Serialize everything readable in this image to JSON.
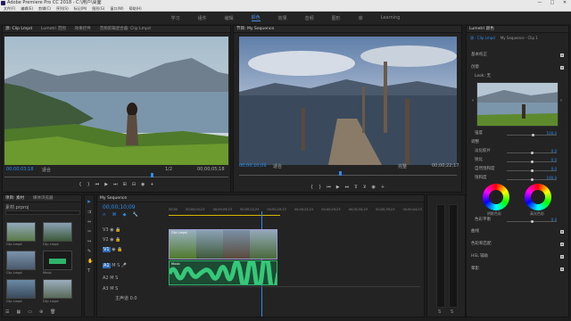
{
  "app": {
    "title": "Adobe Premiere Pro CC 2018 - C:\\用户\\桌面",
    "win_min": "—",
    "win_max": "□",
    "win_close": "✕"
  },
  "menu": [
    "文件(F)",
    "编辑(E)",
    "剪辑(C)",
    "序列(S)",
    "标记(M)",
    "图形(G)",
    "窗口(W)",
    "帮助(H)"
  ],
  "workspaces": [
    {
      "label": "学习"
    },
    {
      "label": "组件"
    },
    {
      "label": "编辑"
    },
    {
      "label": "颜色",
      "active": true
    },
    {
      "label": "效果"
    },
    {
      "label": "音频"
    },
    {
      "label": "图形"
    },
    {
      "label": "库"
    },
    {
      "label": "Learning"
    }
  ],
  "source": {
    "tabs": [
      "源: Clip Lmpd",
      "Lumetri 范围",
      "效果控件",
      "音频剪辑混合器: Clip Lmpd"
    ],
    "timecode": "00;00;03;18",
    "fit": "适合",
    "full": "1/2",
    "duration": "00;00;05;18"
  },
  "program": {
    "tab": "节目: My Sequence",
    "timecode": "00;00;10;09",
    "fit": "适合",
    "full": "完整",
    "duration": "00;00;22;17"
  },
  "project": {
    "tabs": [
      "项目: 素材",
      "媒体浏览器"
    ],
    "path": "素材.prproj",
    "clips": [
      "Clip Lmpd",
      "Clip Lmpd",
      "Clip Lmpd",
      "Clip Lmpd",
      "Clip Lmpd",
      "Music"
    ]
  },
  "timeline": {
    "tab": "My Sequence",
    "timecode": "00;00;10;09",
    "ruler": [
      "00;00",
      "00;00;04;23",
      "00;00;09;23",
      "00;00;14;23",
      "00;00;19;23",
      "00;00;24;23",
      "00;00;29;23",
      "00;00;34;23",
      "00;00;39;23",
      "00;00;44;23"
    ],
    "tracks": [
      "V3",
      "V2",
      "V1",
      "A1",
      "A2",
      "A3"
    ],
    "master": "主声道",
    "master_val": "0.0",
    "clip_v": "Clip Lmpd",
    "clip_a": "Music"
  },
  "meter": {
    "labels": [
      "S",
      "S"
    ]
  },
  "lumetri": {
    "tab": "Lumetri 颜色",
    "source": "源 · Clip Lmpd",
    "seq": "My Sequence · Clip 1",
    "basic": "基本校正",
    "creative": "创意",
    "look": "Look:",
    "look_val": "无",
    "intensity": "强度",
    "intensity_val": "100.0",
    "adjust": "调整",
    "faded": "淡化胶片",
    "faded_val": "0.0",
    "sharpen": "锐化",
    "sharpen_val": "0.0",
    "vibrance": "自然饱和度",
    "vibrance_val": "0.0",
    "saturation": "饱和度",
    "saturation_val": "100.0",
    "shadow_tint": "阴影色彩",
    "highlight_tint": "高光色彩",
    "tint_balance": "色彩平衡",
    "tint_balance_val": "0.0",
    "curves": "曲线",
    "wheels": "色轮和匹配",
    "hsl": "HSL 辅助",
    "vignette": "晕影"
  }
}
